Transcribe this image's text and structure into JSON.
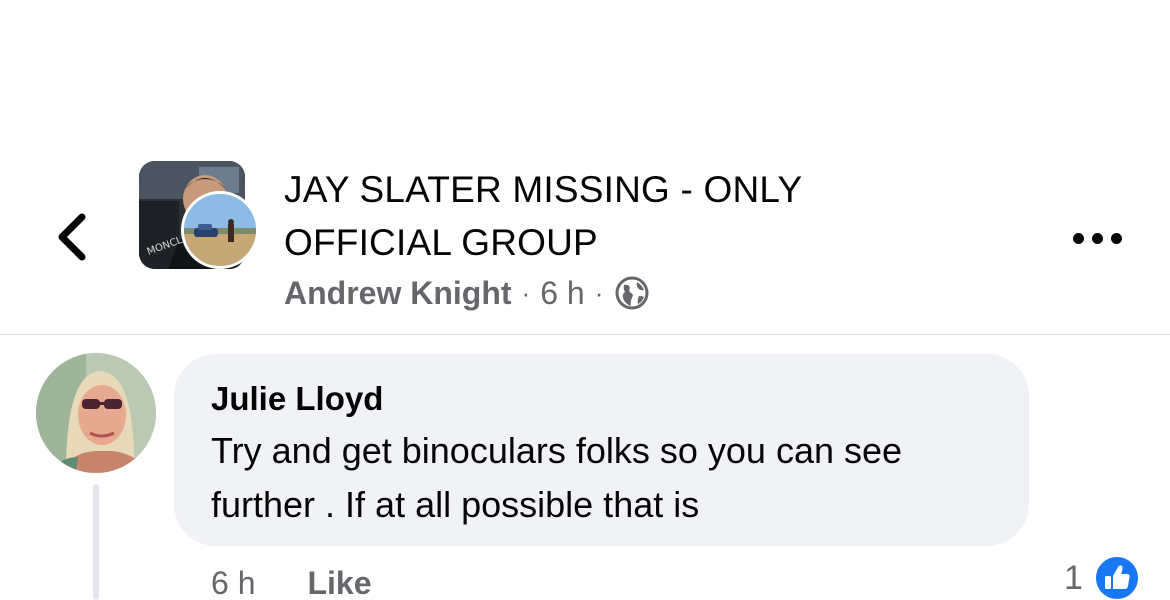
{
  "header": {
    "back_icon": "chevron-left-icon",
    "group_title_line1": "JAY SLATER MISSING - ONLY",
    "group_title_line2": "OFFICIAL GROUP",
    "author": "Andrew Knight",
    "separator": "·",
    "time": "6 h",
    "privacy_icon": "globe-icon",
    "more_icon": "more-horizontal-icon"
  },
  "comment": {
    "author": "Julie Lloyd",
    "text": "Try and get binoculars folks so you can see further . If at all possible that is",
    "time": "6 h",
    "like_label": "Like",
    "reaction_count": "1",
    "reaction_icon": "like-reaction-icon"
  },
  "colors": {
    "bubble": "#f0f2f5",
    "secondary_text": "#65676b",
    "like_blue": "#1877f2",
    "divider": "#dadde1"
  }
}
